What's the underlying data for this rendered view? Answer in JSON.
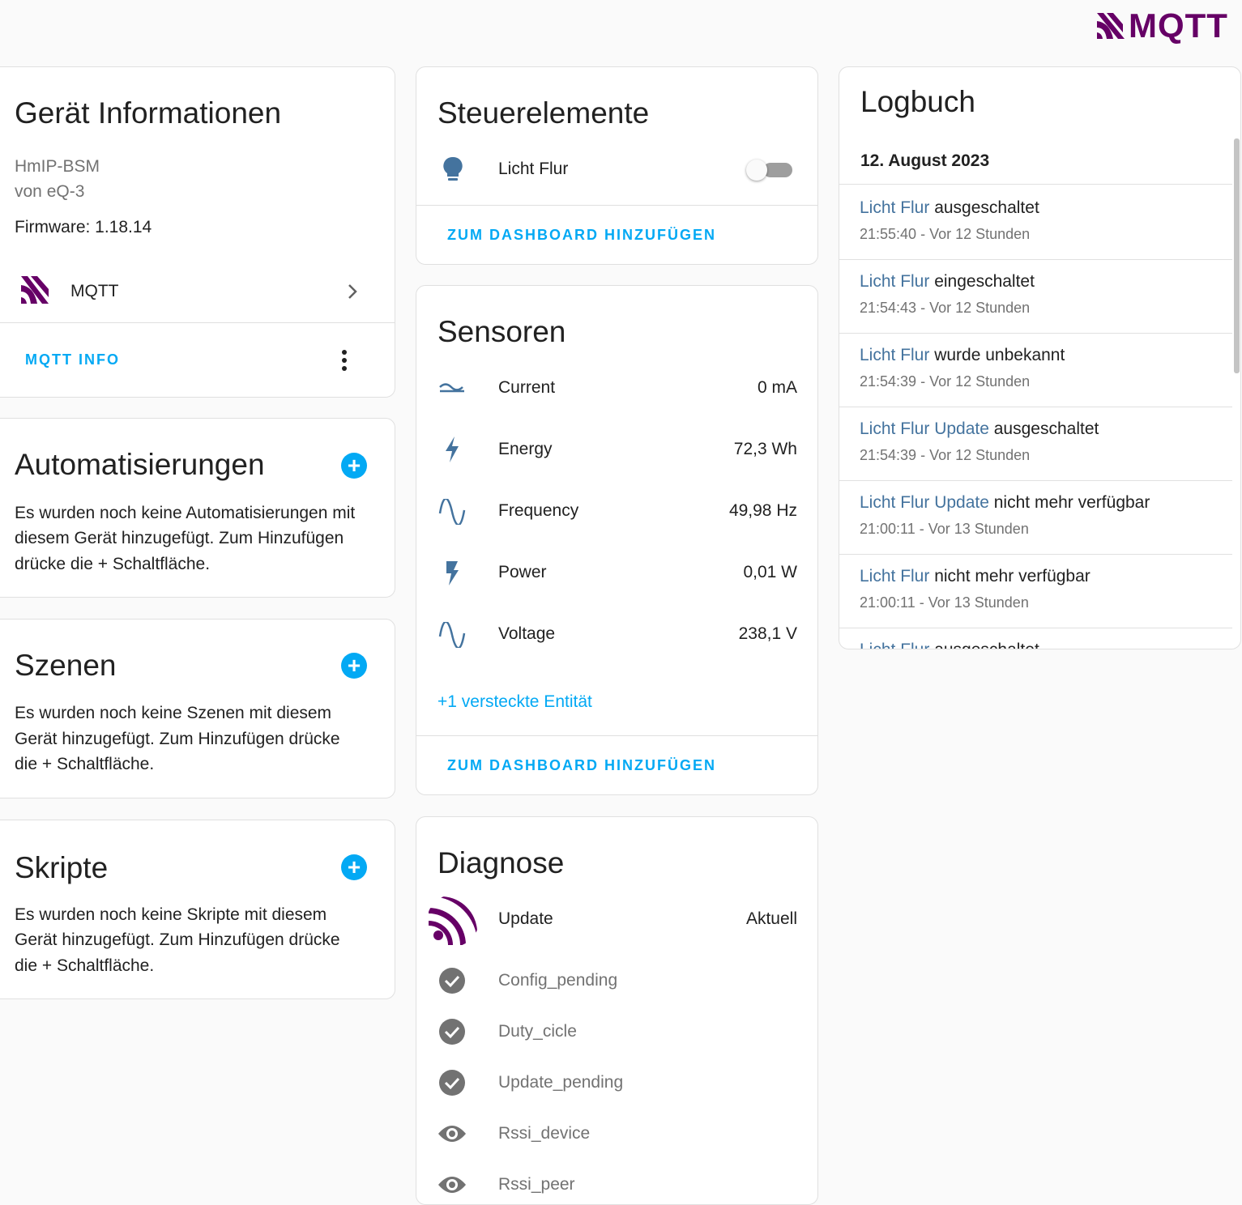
{
  "header": {
    "logo_text": "MQTT",
    "logo_color": "#660066"
  },
  "device_info": {
    "title": "Gerät Informationen",
    "model": "HmIP-BSM",
    "manufacturer": "von eQ-3",
    "firmware": "Firmware: 1.18.14",
    "integration": "MQTT",
    "action": "MQTT INFO"
  },
  "automations": {
    "title": "Automatisierungen",
    "empty_lines": [
      "Es wurden noch keine Automatisierungen mit",
      "diesem Gerät hinzugefügt. Zum Hinzufügen",
      "drücke die + Schaltfläche."
    ]
  },
  "scenes": {
    "title": "Szenen",
    "empty_lines": [
      "Es wurden noch keine Szenen mit diesem",
      "Gerät hinzugefügt. Zum Hinzufügen drücke",
      "die + Schaltfläche."
    ]
  },
  "scripts": {
    "title": "Skripte",
    "empty_lines": [
      "Es wurden noch keine Skripte mit diesem",
      "Gerät hinzugefügt. Zum Hinzufügen drücke",
      "die + Schaltfläche."
    ]
  },
  "controls": {
    "title": "Steuerelemente",
    "items": [
      {
        "name": "Licht Flur",
        "icon": "lightbulb-icon",
        "state": "off"
      }
    ],
    "action": "ZUM DASHBOARD HINZUFÜGEN"
  },
  "sensors": {
    "title": "Sensoren",
    "items": [
      {
        "name": "Current",
        "value": "0 mA",
        "icon": "current-ac-icon"
      },
      {
        "name": "Energy",
        "value": "72,3 Wh",
        "icon": "lightning-bolt-icon"
      },
      {
        "name": "Frequency",
        "value": "49,98 Hz",
        "icon": "sine-wave-icon"
      },
      {
        "name": "Power",
        "value": "0,01 W",
        "icon": "flash-icon"
      },
      {
        "name": "Voltage",
        "value": "238,1 V",
        "icon": "sine-wave-icon"
      }
    ],
    "hidden_link": "+1 versteckte Entität",
    "action": "ZUM DASHBOARD HINZUFÜGEN"
  },
  "diagnostics": {
    "title": "Diagnose",
    "update": {
      "name": "Update",
      "value": "Aktuell"
    },
    "items": [
      {
        "name": "Config_pending",
        "icon": "check-circle-icon"
      },
      {
        "name": "Duty_cicle",
        "icon": "check-circle-icon"
      },
      {
        "name": "Update_pending",
        "icon": "check-circle-icon"
      },
      {
        "name": "Rssi_device",
        "icon": "eye-icon"
      },
      {
        "name": "Rssi_peer",
        "icon": "eye-icon"
      }
    ]
  },
  "logbook": {
    "title": "Logbuch",
    "date": "12. August 2023",
    "entries": [
      {
        "entity": "Licht Flur",
        "message": " ausgeschaltet",
        "time": "21:55:40 - Vor 12 Stunden"
      },
      {
        "entity": "Licht Flur",
        "message": " eingeschaltet",
        "time": "21:54:43 - Vor 12 Stunden"
      },
      {
        "entity": "Licht Flur",
        "message": " wurde unbekannt",
        "time": "21:54:39 - Vor 12 Stunden"
      },
      {
        "entity": "Licht Flur Update",
        "message": " ausgeschaltet",
        "time": "21:54:39 - Vor 12 Stunden"
      },
      {
        "entity": "Licht Flur Update",
        "message": " nicht mehr verfügbar",
        "time": "21:00:11 - Vor 13 Stunden"
      },
      {
        "entity": "Licht Flur",
        "message": " nicht mehr verfügbar",
        "time": "21:00:11 - Vor 13 Stunden"
      },
      {
        "entity": "Licht Flur",
        "message": " ausgeschaltet",
        "time": ""
      }
    ]
  }
}
